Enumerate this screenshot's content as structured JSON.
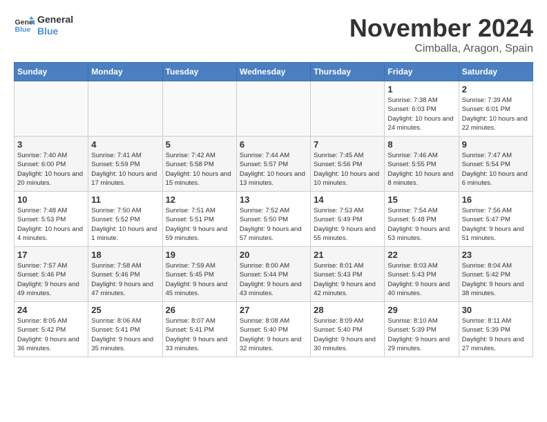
{
  "logo": {
    "line1": "General",
    "line2": "Blue"
  },
  "title": "November 2024",
  "location": "Cimballa, Aragon, Spain",
  "days_of_week": [
    "Sunday",
    "Monday",
    "Tuesday",
    "Wednesday",
    "Thursday",
    "Friday",
    "Saturday"
  ],
  "weeks": [
    [
      {
        "day": "",
        "info": ""
      },
      {
        "day": "",
        "info": ""
      },
      {
        "day": "",
        "info": ""
      },
      {
        "day": "",
        "info": ""
      },
      {
        "day": "",
        "info": ""
      },
      {
        "day": "1",
        "info": "Sunrise: 7:38 AM\nSunset: 6:03 PM\nDaylight: 10 hours and 24 minutes."
      },
      {
        "day": "2",
        "info": "Sunrise: 7:39 AM\nSunset: 6:01 PM\nDaylight: 10 hours and 22 minutes."
      }
    ],
    [
      {
        "day": "3",
        "info": "Sunrise: 7:40 AM\nSunset: 6:00 PM\nDaylight: 10 hours and 20 minutes."
      },
      {
        "day": "4",
        "info": "Sunrise: 7:41 AM\nSunset: 5:59 PM\nDaylight: 10 hours and 17 minutes."
      },
      {
        "day": "5",
        "info": "Sunrise: 7:42 AM\nSunset: 5:58 PM\nDaylight: 10 hours and 15 minutes."
      },
      {
        "day": "6",
        "info": "Sunrise: 7:44 AM\nSunset: 5:57 PM\nDaylight: 10 hours and 13 minutes."
      },
      {
        "day": "7",
        "info": "Sunrise: 7:45 AM\nSunset: 5:56 PM\nDaylight: 10 hours and 10 minutes."
      },
      {
        "day": "8",
        "info": "Sunrise: 7:46 AM\nSunset: 5:55 PM\nDaylight: 10 hours and 8 minutes."
      },
      {
        "day": "9",
        "info": "Sunrise: 7:47 AM\nSunset: 5:54 PM\nDaylight: 10 hours and 6 minutes."
      }
    ],
    [
      {
        "day": "10",
        "info": "Sunrise: 7:48 AM\nSunset: 5:53 PM\nDaylight: 10 hours and 4 minutes."
      },
      {
        "day": "11",
        "info": "Sunrise: 7:50 AM\nSunset: 5:52 PM\nDaylight: 10 hours and 1 minute."
      },
      {
        "day": "12",
        "info": "Sunrise: 7:51 AM\nSunset: 5:51 PM\nDaylight: 9 hours and 59 minutes."
      },
      {
        "day": "13",
        "info": "Sunrise: 7:52 AM\nSunset: 5:50 PM\nDaylight: 9 hours and 57 minutes."
      },
      {
        "day": "14",
        "info": "Sunrise: 7:53 AM\nSunset: 5:49 PM\nDaylight: 9 hours and 55 minutes."
      },
      {
        "day": "15",
        "info": "Sunrise: 7:54 AM\nSunset: 5:48 PM\nDaylight: 9 hours and 53 minutes."
      },
      {
        "day": "16",
        "info": "Sunrise: 7:56 AM\nSunset: 5:47 PM\nDaylight: 9 hours and 51 minutes."
      }
    ],
    [
      {
        "day": "17",
        "info": "Sunrise: 7:57 AM\nSunset: 5:46 PM\nDaylight: 9 hours and 49 minutes."
      },
      {
        "day": "18",
        "info": "Sunrise: 7:58 AM\nSunset: 5:46 PM\nDaylight: 9 hours and 47 minutes."
      },
      {
        "day": "19",
        "info": "Sunrise: 7:59 AM\nSunset: 5:45 PM\nDaylight: 9 hours and 45 minutes."
      },
      {
        "day": "20",
        "info": "Sunrise: 8:00 AM\nSunset: 5:44 PM\nDaylight: 9 hours and 43 minutes."
      },
      {
        "day": "21",
        "info": "Sunrise: 8:01 AM\nSunset: 5:43 PM\nDaylight: 9 hours and 42 minutes."
      },
      {
        "day": "22",
        "info": "Sunrise: 8:03 AM\nSunset: 5:43 PM\nDaylight: 9 hours and 40 minutes."
      },
      {
        "day": "23",
        "info": "Sunrise: 8:04 AM\nSunset: 5:42 PM\nDaylight: 9 hours and 38 minutes."
      }
    ],
    [
      {
        "day": "24",
        "info": "Sunrise: 8:05 AM\nSunset: 5:42 PM\nDaylight: 9 hours and 36 minutes."
      },
      {
        "day": "25",
        "info": "Sunrise: 8:06 AM\nSunset: 5:41 PM\nDaylight: 9 hours and 35 minutes."
      },
      {
        "day": "26",
        "info": "Sunrise: 8:07 AM\nSunset: 5:41 PM\nDaylight: 9 hours and 33 minutes."
      },
      {
        "day": "27",
        "info": "Sunrise: 8:08 AM\nSunset: 5:40 PM\nDaylight: 9 hours and 32 minutes."
      },
      {
        "day": "28",
        "info": "Sunrise: 8:09 AM\nSunset: 5:40 PM\nDaylight: 9 hours and 30 minutes."
      },
      {
        "day": "29",
        "info": "Sunrise: 8:10 AM\nSunset: 5:39 PM\nDaylight: 9 hours and 29 minutes."
      },
      {
        "day": "30",
        "info": "Sunrise: 8:11 AM\nSunset: 5:39 PM\nDaylight: 9 hours and 27 minutes."
      }
    ]
  ]
}
